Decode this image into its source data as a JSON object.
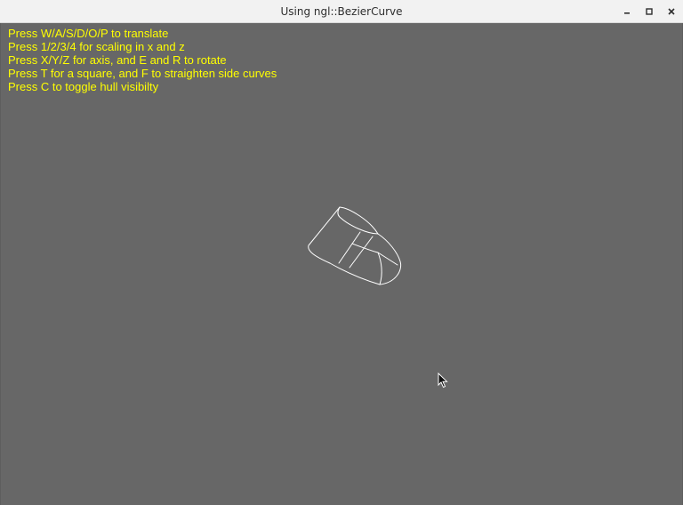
{
  "window": {
    "title": "Using ngl::BezierCurve",
    "controls": {
      "minimize_icon": "minimize-icon",
      "maximize_icon": "maximize-icon",
      "close_icon": "close-icon"
    }
  },
  "viewport": {
    "background": "#676767",
    "text_color": "#ffff00",
    "wire_color": "#ffffff",
    "instructions": [
      "Press W/A/S/D/O/P to translate",
      "Press 1/2/3/4 for scaling in x and z",
      "Press X/Y/Z for axis, and E and R to rotate",
      "Press T for a square, and F to straighten side curves",
      "Press C to toggle hull visibilty"
    ]
  }
}
